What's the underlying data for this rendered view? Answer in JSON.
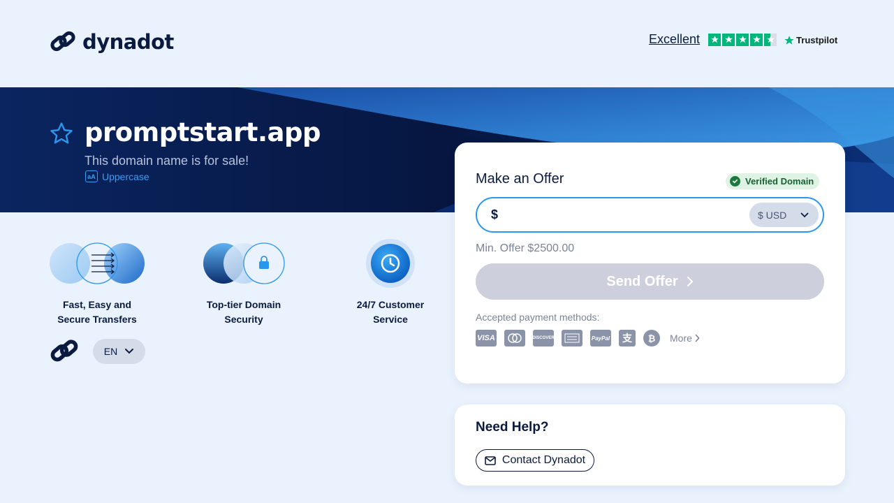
{
  "header": {
    "brand": "dynadot",
    "trustpilot": {
      "rating_text": "Excellent",
      "stars": 4.5,
      "brand": "Trustpilot"
    }
  },
  "banner": {
    "domain": "promptstart.app",
    "subtitle": "This domain name is for sale!",
    "uppercase_label": "Uppercase",
    "uppercase_icon_text": "aA"
  },
  "features": [
    {
      "label_line1": "Fast, Easy and",
      "label_line2": "Secure Transfers",
      "icon": "transfer-icon"
    },
    {
      "label_line1": "Top-tier Domain",
      "label_line2": "Security",
      "icon": "lock-icon"
    },
    {
      "label_line1": "24/7 Customer",
      "label_line2": "Service",
      "icon": "clock-icon"
    }
  ],
  "language": {
    "selected": "EN"
  },
  "offer": {
    "title": "Make an Offer",
    "verified_label": "Verified Domain",
    "currency_symbol": "$",
    "input_value": "",
    "currency_selected": "$ USD",
    "min_offer": "Min. Offer $2500.00",
    "send_label": "Send Offer",
    "accepted_label": "Accepted payment methods:",
    "payment_methods": [
      "VISA",
      "Mastercard",
      "DISCOVER",
      "American Express",
      "PayPal",
      "Alipay",
      "Bitcoin"
    ],
    "more_label": "More"
  },
  "help": {
    "title": "Need Help?",
    "contact_label": "Contact Dynadot"
  },
  "colors": {
    "accent": "#2a97ee",
    "navy": "#0b1b3f",
    "page_bg": "#eaf2fd",
    "trustpilot_green": "#00b67a",
    "verified_green": "#1b7a3e"
  }
}
